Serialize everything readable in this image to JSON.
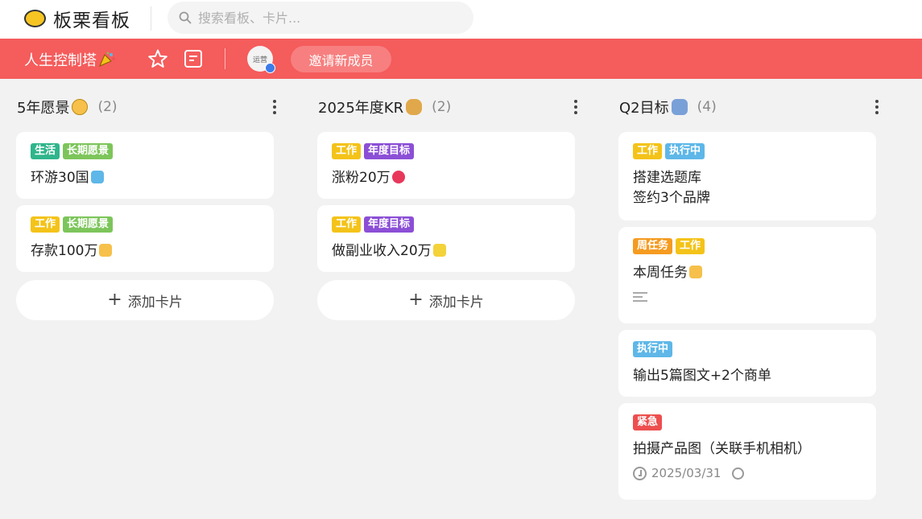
{
  "app": {
    "name": "板栗看板"
  },
  "search": {
    "placeholder": "搜索看板、卡片..."
  },
  "board": {
    "title": "人生控制塔",
    "avatar_text": "运营",
    "invite_label": "邀请新成员"
  },
  "colors": {
    "board_bar": "#f55c5c",
    "tag_生活": "#2fb58b",
    "tag_长期愿景": "#7cc55a",
    "tag_工作": "#f4c319",
    "tag_年度目标": "#8b4fd6",
    "tag_执行中": "#5eb7e8",
    "tag_周任务": "#f59b20",
    "tag_紧急": "#ee4e4e"
  },
  "columns": [
    {
      "title": "5年愿景",
      "count": "(2)",
      "add_label": "添加卡片",
      "cards": [
        {
          "tags": [
            "生活",
            "长期愿景"
          ],
          "text": "环游30国",
          "emoji": "airplane-emoji"
        },
        {
          "tags": [
            "工作",
            "长期愿景"
          ],
          "text": "存款100万",
          "emoji": "clap-emoji"
        }
      ]
    },
    {
      "title": "2025年度KR",
      "count": "(2)",
      "add_label": "添加卡片",
      "cards": [
        {
          "tags": [
            "工作",
            "年度目标"
          ],
          "text": "涨粉20万",
          "emoji": "heart-emoji"
        },
        {
          "tags": [
            "工作",
            "年度目标"
          ],
          "text": "做副业收入20万",
          "emoji": "sparkles-emoji"
        }
      ]
    },
    {
      "title": "Q2目标",
      "count": "(4)",
      "cards": [
        {
          "tags": [
            "工作",
            "执行中"
          ],
          "text_lines": [
            "搭建选题库",
            "签约3个品牌"
          ]
        },
        {
          "tags": [
            "周任务",
            "工作"
          ],
          "text": "本周任务",
          "emoji": "point-down-emoji",
          "has_description": true
        },
        {
          "tags": [
            "执行中"
          ],
          "text": "输出5篇图文+2个商单"
        },
        {
          "tags": [
            "紧急"
          ],
          "text": "拍摄产品图（关联手机相机）",
          "due_date": "2025/03/31"
        }
      ]
    }
  ]
}
